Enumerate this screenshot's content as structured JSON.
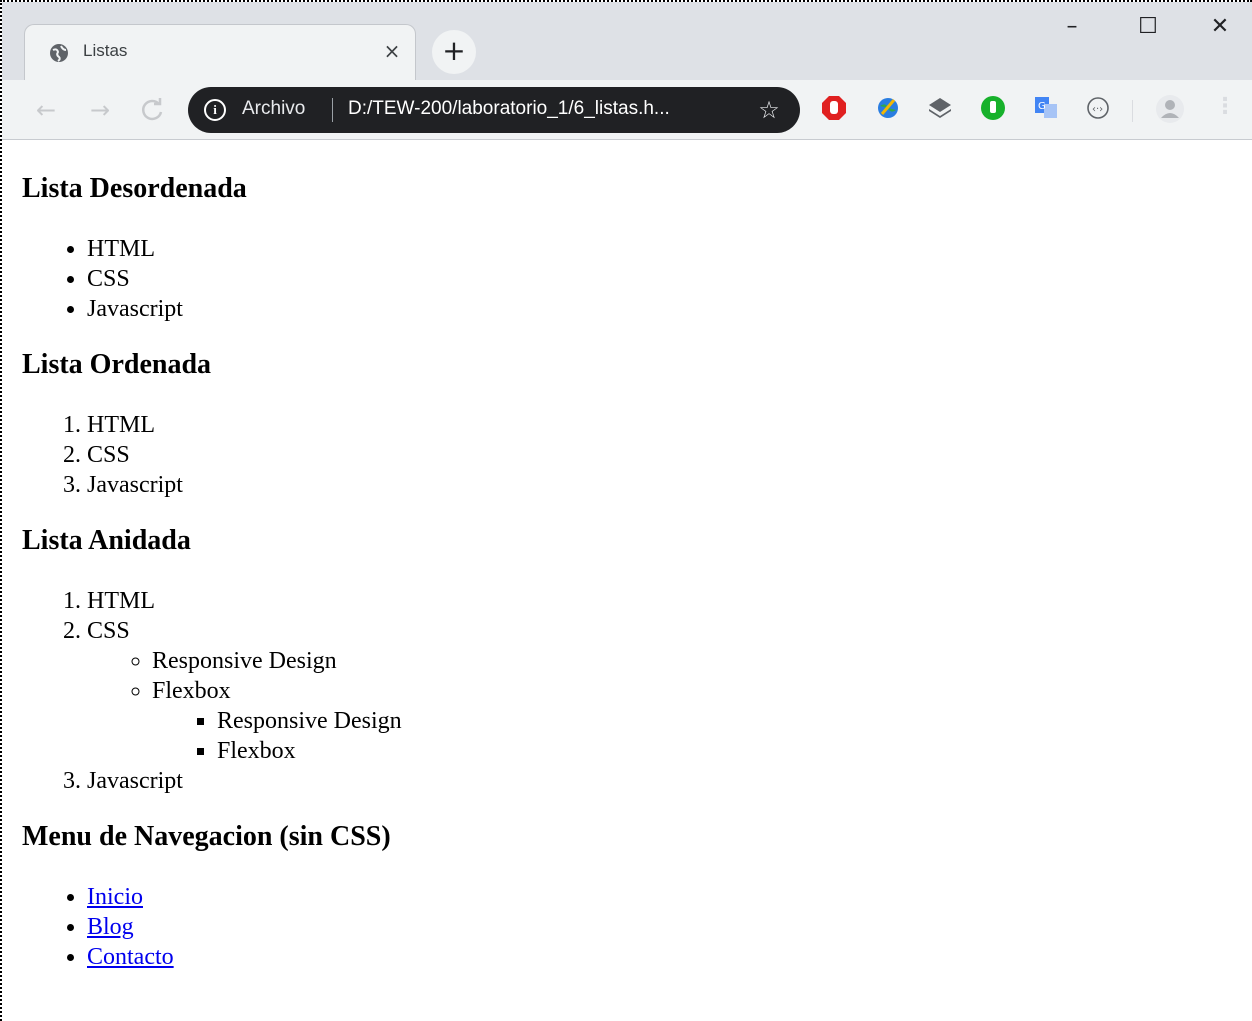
{
  "browser": {
    "tab_title": "Listas",
    "tab_close": "×",
    "new_tab": "+",
    "window": {
      "minimize": "–",
      "maximize": "☐",
      "close": "✕"
    },
    "toolbar": {
      "back": "←",
      "forward": "→",
      "reload": "C",
      "site_info_label": "Archivo",
      "url": "D:/TEW-200/laboratorio_1/6_listas.h...",
      "star": "☆",
      "menu": "⋮"
    },
    "extensions": [
      "adblock-icon",
      "globe-extension-icon",
      "layers-extension-icon",
      "hand-extension-icon",
      "translate-icon",
      "code-extension-icon"
    ],
    "colors": {
      "omnibox_bg": "#202124",
      "titlebar_bg": "#dee1e6",
      "toolbar_bg": "#f1f3f4",
      "link": "#0000ee"
    }
  },
  "page": {
    "unordered": {
      "heading": "Lista Desordenada",
      "items": [
        "HTML",
        "CSS",
        "Javascript"
      ]
    },
    "ordered": {
      "heading": "Lista Ordenada",
      "items": [
        "HTML",
        "CSS",
        "Javascript"
      ]
    },
    "nested": {
      "heading": "Lista Anidada",
      "items": [
        "HTML",
        "CSS",
        "Javascript"
      ],
      "sub_items": [
        "Responsive Design",
        "Flexbox"
      ],
      "sub_sub_items": [
        "Responsive Design",
        "Flexbox"
      ]
    },
    "nav": {
      "heading": "Menu de Navegacion (sin CSS)",
      "links": [
        "Inicio",
        "Blog",
        "Contacto"
      ]
    }
  }
}
